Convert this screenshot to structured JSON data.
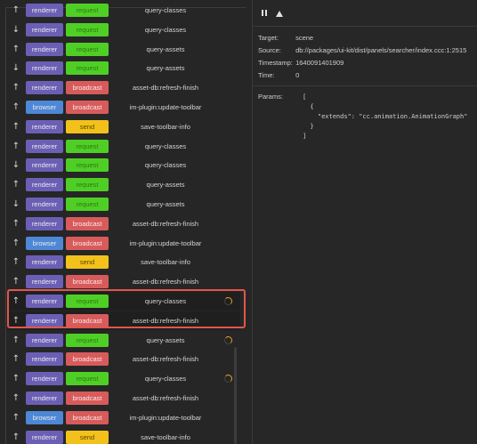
{
  "messages": [
    {
      "dir": "↑",
      "source": "renderer",
      "type": "request",
      "name": "query-classes",
      "pending": false
    },
    {
      "dir": "↓",
      "source": "renderer",
      "type": "request",
      "name": "query-classes",
      "pending": false
    },
    {
      "dir": "↑",
      "source": "renderer",
      "type": "request",
      "name": "query-assets",
      "pending": false
    },
    {
      "dir": "↓",
      "source": "renderer",
      "type": "request",
      "name": "query-assets",
      "pending": false
    },
    {
      "dir": "↑",
      "source": "renderer",
      "type": "broadcast",
      "name": "asset-db:refresh-finish",
      "pending": false
    },
    {
      "dir": "↑",
      "source": "browser",
      "type": "broadcast",
      "name": "im-plugin:update-toolbar",
      "pending": false
    },
    {
      "dir": "↑",
      "source": "renderer",
      "type": "send",
      "name": "save-toolbar-info",
      "pending": false
    },
    {
      "dir": "↑",
      "source": "renderer",
      "type": "request",
      "name": "query-classes",
      "pending": false
    },
    {
      "dir": "↓",
      "source": "renderer",
      "type": "request",
      "name": "query-classes",
      "pending": false
    },
    {
      "dir": "↑",
      "source": "renderer",
      "type": "request",
      "name": "query-assets",
      "pending": false
    },
    {
      "dir": "↓",
      "source": "renderer",
      "type": "request",
      "name": "query-assets",
      "pending": false
    },
    {
      "dir": "↑",
      "source": "renderer",
      "type": "broadcast",
      "name": "asset-db:refresh-finish",
      "pending": false
    },
    {
      "dir": "↑",
      "source": "browser",
      "type": "broadcast",
      "name": "im-plugin:update-toolbar",
      "pending": false
    },
    {
      "dir": "↑",
      "source": "renderer",
      "type": "send",
      "name": "save-toolbar-info",
      "pending": false
    },
    {
      "dir": "↑",
      "source": "renderer",
      "type": "broadcast",
      "name": "asset-db:refresh-finish",
      "pending": false
    },
    {
      "dir": "↑",
      "source": "renderer",
      "type": "request",
      "name": "query-classes",
      "pending": true
    },
    {
      "dir": "↑",
      "source": "renderer",
      "type": "broadcast",
      "name": "asset-db:refresh-finish",
      "pending": false
    },
    {
      "dir": "↑",
      "source": "renderer",
      "type": "request",
      "name": "query-assets",
      "pending": true
    },
    {
      "dir": "↑",
      "source": "renderer",
      "type": "broadcast",
      "name": "asset-db:refresh-finish",
      "pending": false
    },
    {
      "dir": "↑",
      "source": "renderer",
      "type": "request",
      "name": "query-classes",
      "pending": true
    },
    {
      "dir": "↑",
      "source": "renderer",
      "type": "broadcast",
      "name": "asset-db:refresh-finish",
      "pending": false
    },
    {
      "dir": "↑",
      "source": "browser",
      "type": "broadcast",
      "name": "im-plugin:update-toolbar",
      "pending": false
    },
    {
      "dir": "↑",
      "source": "renderer",
      "type": "send",
      "name": "save-toolbar-info",
      "pending": false
    }
  ],
  "toolbar": {
    "pause_icon": "pause-icon",
    "clear_icon": "clear-icon"
  },
  "detail": {
    "target_label": "Target:",
    "target": "scene",
    "source_label": "Source:",
    "source": "db://packages/ui-kit/dist/panels/searcher/index.ccc:1:2515",
    "timestamp_label": "Timestamp:",
    "timestamp": "1640091401909",
    "time_label": "Time:",
    "time": "0",
    "params_label": "Params:",
    "params_code": "[\n  {\n    \"extends\": \"cc.animation.AnimationGraph\"\n  }\n]"
  },
  "colors": {
    "renderer": "#6b5fb5",
    "browser": "#4d87d6",
    "request": "#4fcf25",
    "broadcast": "#d85b5b",
    "send": "#f2c11c",
    "highlight_border": "#e0564e"
  }
}
